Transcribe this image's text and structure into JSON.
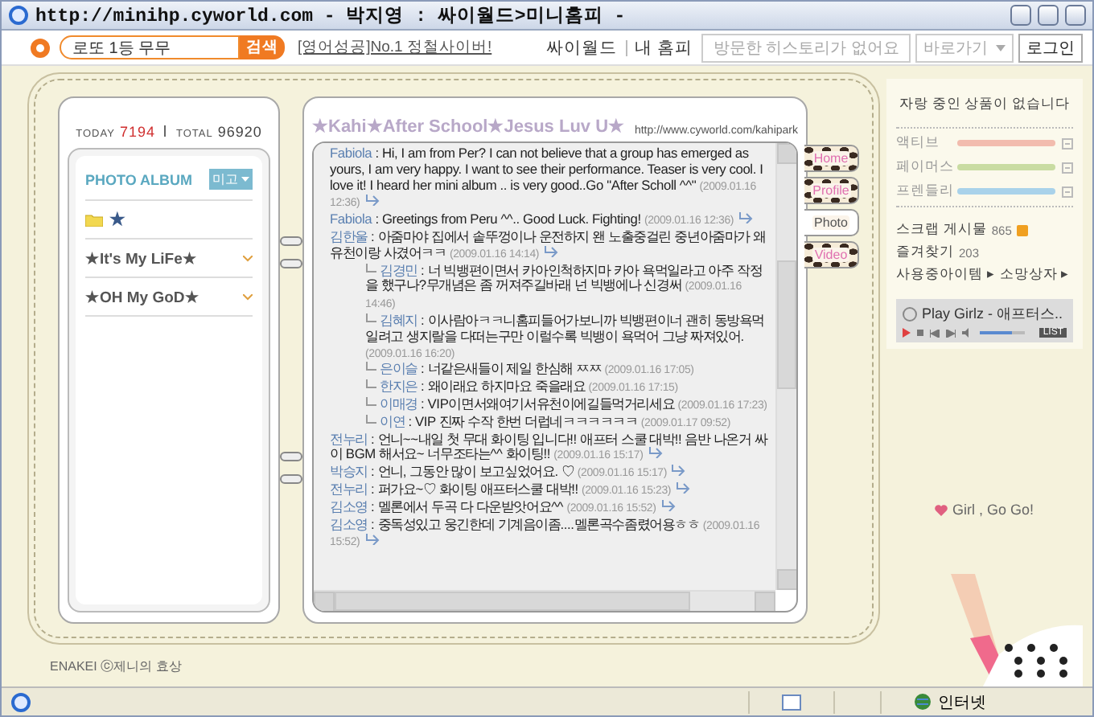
{
  "window": {
    "title": "http://minihp.cyworld.com - 박지영 : 싸이월드>미니홈피 -"
  },
  "toolbar": {
    "search": {
      "value": "로또 1등 무무"
    },
    "search_button": "검색",
    "ad_link": "[영어성공]No.1 정철사이버!",
    "links": [
      "싸이월드",
      "내 홈피"
    ],
    "history": "방문한 히스토리가 없어요",
    "shortcut": "바로가기",
    "login": "로그인"
  },
  "counter": {
    "today_label": "TODAY",
    "today": "7194",
    "total_label": "TOTAL",
    "total": "96920"
  },
  "album": {
    "title": "PHOTO ALBUM",
    "button": "미고",
    "folders": [
      {
        "kind": "root",
        "label": "★"
      },
      {
        "kind": "folder",
        "label": "★It's My LiFe★"
      },
      {
        "kind": "folder",
        "label": "★OH My GoD★"
      }
    ]
  },
  "page": {
    "title": "★Kahi★After School★Jesus Luv U★",
    "url": "http://www.cyworld.com/kahipark"
  },
  "comments": [
    {
      "author": "Fabiola",
      "text": ": Hi, I am from Per? I can not believe that a group has emerged as yours, I am very happy. I want to see their performance. Teaser is very cool. I love it! I heard her mini album .. is very good..Go \"After Scholl ^^\"",
      "time": "(2009.01.16 12:36)"
    },
    {
      "author": "Fabiola",
      "text": ": Greetings from Peru ^^.. Good Luck. Fighting!",
      "time": "(2009.01.16 12:36)"
    },
    {
      "author": "김한울",
      "text": ": 아줌마야 집에서 솥뚜껑이나 운전하지 왠 노출중걸린 중년아줌마가 왜 유천이랑 사겼어ㅋㅋ",
      "time": "(2009.01.16 14:14)",
      "replies": [
        {
          "author": "김경민",
          "text": ": 너 빅뱅편이면서 카아인척하지마 카아 욕먹일라고 아주 작정을 했구나?무개념은 좀 꺼져주길바래 넌 빅뱅에나 신경써",
          "time": "(2009.01.16 14:46)"
        },
        {
          "author": "김혜지",
          "text": ": 이사람아ㅋㅋ니홈피들어가보니까 빅뱅편이너 괜히 동방욕먹일려고 생지랄을 다떠는구만 이럴수록 빅뱅이 욕먹어 그냥 짜져있어.",
          "time": "(2009.01.16 16:20)"
        },
        {
          "author": "은이슬",
          "text": ": 너같은새들이 제일 한심해 ㅉㅉ",
          "time": "(2009.01.16 17:05)"
        },
        {
          "author": "한지은",
          "text": ": 왜이래요 하지마요 죽을래요",
          "time": "(2009.01.16 17:15)"
        },
        {
          "author": "이매경",
          "text": ": VIP이면서왜여기서유천이에길들먹거리세요",
          "time": "(2009.01.16 17:23)"
        },
        {
          "author": "이연",
          "text": ": VIP 진짜 수작 한번 더럽네ㅋㅋㅋㅋㅋㅋ",
          "time": "(2009.01.17 09:52)"
        }
      ]
    },
    {
      "author": "전누리",
      "text": ": 언니~~내일 첫 무대 화이팅 입니다!! 애프터 스쿨 대박!! 음반 나온거 싸이 BGM 해서요~ 너무조타는^^ 화이팅!!",
      "time": "(2009.01.16 15:17)"
    },
    {
      "author": "박승지",
      "text": ": 언니, 그동안 많이 보고싶었어요. ♡",
      "time": "(2009.01.16 15:17)"
    },
    {
      "author": "전누리",
      "text": ": 퍼가요~♡ 화이팅 애프터스쿨 대박!!",
      "time": "(2009.01.16 15:23)"
    },
    {
      "author": "김소영",
      "text": ": 멜론에서 두곡 다 다운받앗어요^^",
      "time": "(2009.01.16 15:52)"
    },
    {
      "author": "김소영",
      "text": ": 중독성있고 웅긴한데 기계음이좀....멜론곡수좀렸어용ㅎㅎ",
      "time": "(2009.01.16 15:52)"
    }
  ],
  "tabs": [
    {
      "label": "Home",
      "selected": false
    },
    {
      "label": "Profile",
      "selected": false
    },
    {
      "label": "Photo",
      "selected": true
    },
    {
      "label": "Video",
      "selected": false
    }
  ],
  "side": {
    "notice": "자랑 중인 상품이 없습니다",
    "meters": [
      {
        "label": "액티브",
        "color": "#f2bcae"
      },
      {
        "label": "페이머스",
        "color": "#c9dca2"
      },
      {
        "label": "프렌들리",
        "color": "#a9d2ea"
      }
    ],
    "stats": [
      {
        "label": "스크랩 게시물",
        "count": "865"
      },
      {
        "label": "즐겨찾기",
        "count": "203"
      }
    ],
    "links": [
      "사용중아이템 ▸",
      "소망상자 ▸"
    ],
    "player": {
      "track": "Play Girlz - 애프터스..",
      "list": "LIST",
      "level": 0.7
    },
    "greeting": "Girl , Go Go!"
  },
  "footer": "ENAKEI ⓒ제니의 효상",
  "status_bar": {
    "zone": "인터넷"
  }
}
